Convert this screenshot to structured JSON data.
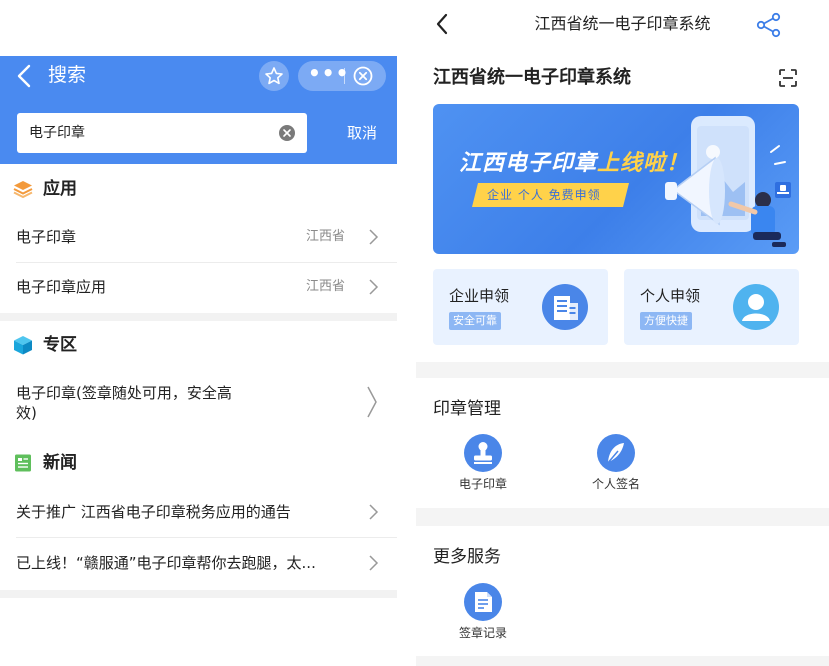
{
  "left": {
    "header": {
      "title": "搜索",
      "search_value": "电子印章",
      "cancel_label": "取消"
    },
    "sections": [
      {
        "title": "应用",
        "icon": "layers-icon",
        "items": [
          {
            "text": "电子印章",
            "meta": "江西省"
          },
          {
            "text": "电子印章应用",
            "meta": "江西省"
          }
        ]
      },
      {
        "title": "专区",
        "icon": "cube-icon",
        "items": [
          {
            "text_line1": "电子印章(签章随处可用，安全高",
            "text_line2": "效)"
          }
        ]
      },
      {
        "title": "新闻",
        "icon": "newspaper-icon",
        "items": [
          {
            "text": "关于推广 江西省电子印章税务应用的通告"
          },
          {
            "text": "已上线！“赣服通”电子印章帮你去跑腿，太..."
          }
        ]
      }
    ]
  },
  "right": {
    "nav_title": "江西省统一电子印章系统",
    "page_title": "江西省统一电子印章系统",
    "banner": {
      "title_part1": "江西电子印章",
      "title_part2": "上线啦！",
      "subtitle": "企业 个人 免费申领"
    },
    "cards": [
      {
        "title": "企业申领",
        "tag": "安全可靠",
        "icon": "building-icon"
      },
      {
        "title": "个人申领",
        "tag": "方便快捷",
        "icon": "person-icon"
      }
    ],
    "seal_management": {
      "title": "印章管理",
      "items": [
        {
          "label": "电子印章",
          "icon": "seal-icon"
        },
        {
          "label": "个人签名",
          "icon": "feather-pen-icon"
        }
      ]
    },
    "more_services": {
      "title": "更多服务",
      "items": [
        {
          "label": "签章记录",
          "icon": "document-icon"
        }
      ]
    }
  },
  "colors": {
    "header_blue": "#4a8af0",
    "card_bg": "#e9f2ff",
    "icon_blue": "#4a86e8",
    "highlight_yellow": "#ffd24a"
  }
}
